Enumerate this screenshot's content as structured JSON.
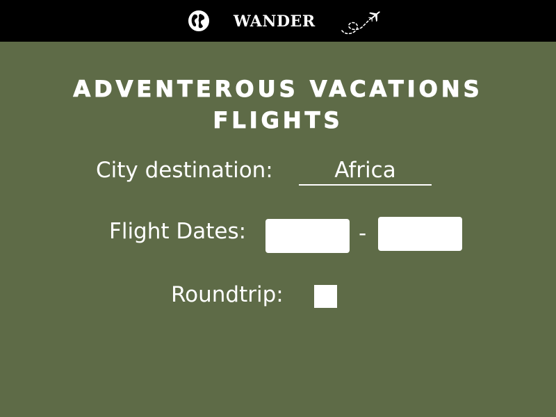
{
  "header": {
    "brand": "WANDER",
    "icons": [
      "globe-icon",
      "airplane-dashed-trail-icon"
    ]
  },
  "main": {
    "title_line1": "ADVENTEROUS VACATIONS",
    "title_line2": "FLIGHTS",
    "city": {
      "label": "City destination:",
      "value": "Africa"
    },
    "dates": {
      "label": "Flight Dates:",
      "start_value": "",
      "separator": "-",
      "end_value": ""
    },
    "roundtrip": {
      "label": "Roundtrip:",
      "checked": false
    }
  },
  "colors": {
    "background": "#5e6b47",
    "topbar": "#000000",
    "text": "#ffffff"
  }
}
